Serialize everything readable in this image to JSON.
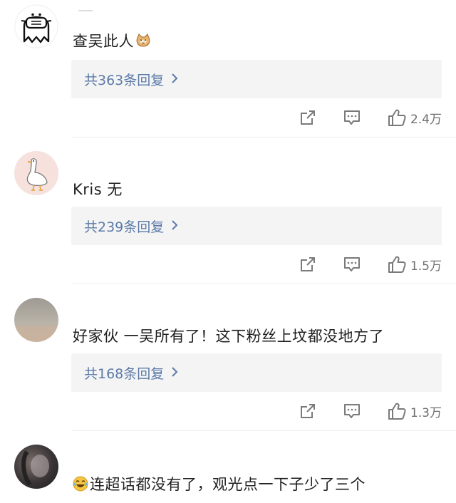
{
  "comments": [
    {
      "text": "查吴此人",
      "emoji": "cat-face",
      "reply_label": "共363条回复",
      "likes": "2.4万"
    },
    {
      "text": "Kris 无",
      "reply_label": "共239条回复",
      "likes": "1.5万"
    },
    {
      "text": "好家伙 一吴所有了！这下粉丝上坟都没地方了",
      "reply_label": "共168条回复",
      "likes": "1.3万"
    },
    {
      "text": "连超话都没有了，观光点一下子少了三个",
      "emoji": "laughing-crying-face"
    }
  ],
  "icons": {
    "share": "share-icon",
    "comment": "comment-icon",
    "like": "like-icon",
    "chevron": "chevron-right-icon"
  },
  "colors": {
    "link": "#5b7aa8",
    "reply_bg": "#f4f4f4",
    "icon_gray": "#7a7a7a"
  }
}
